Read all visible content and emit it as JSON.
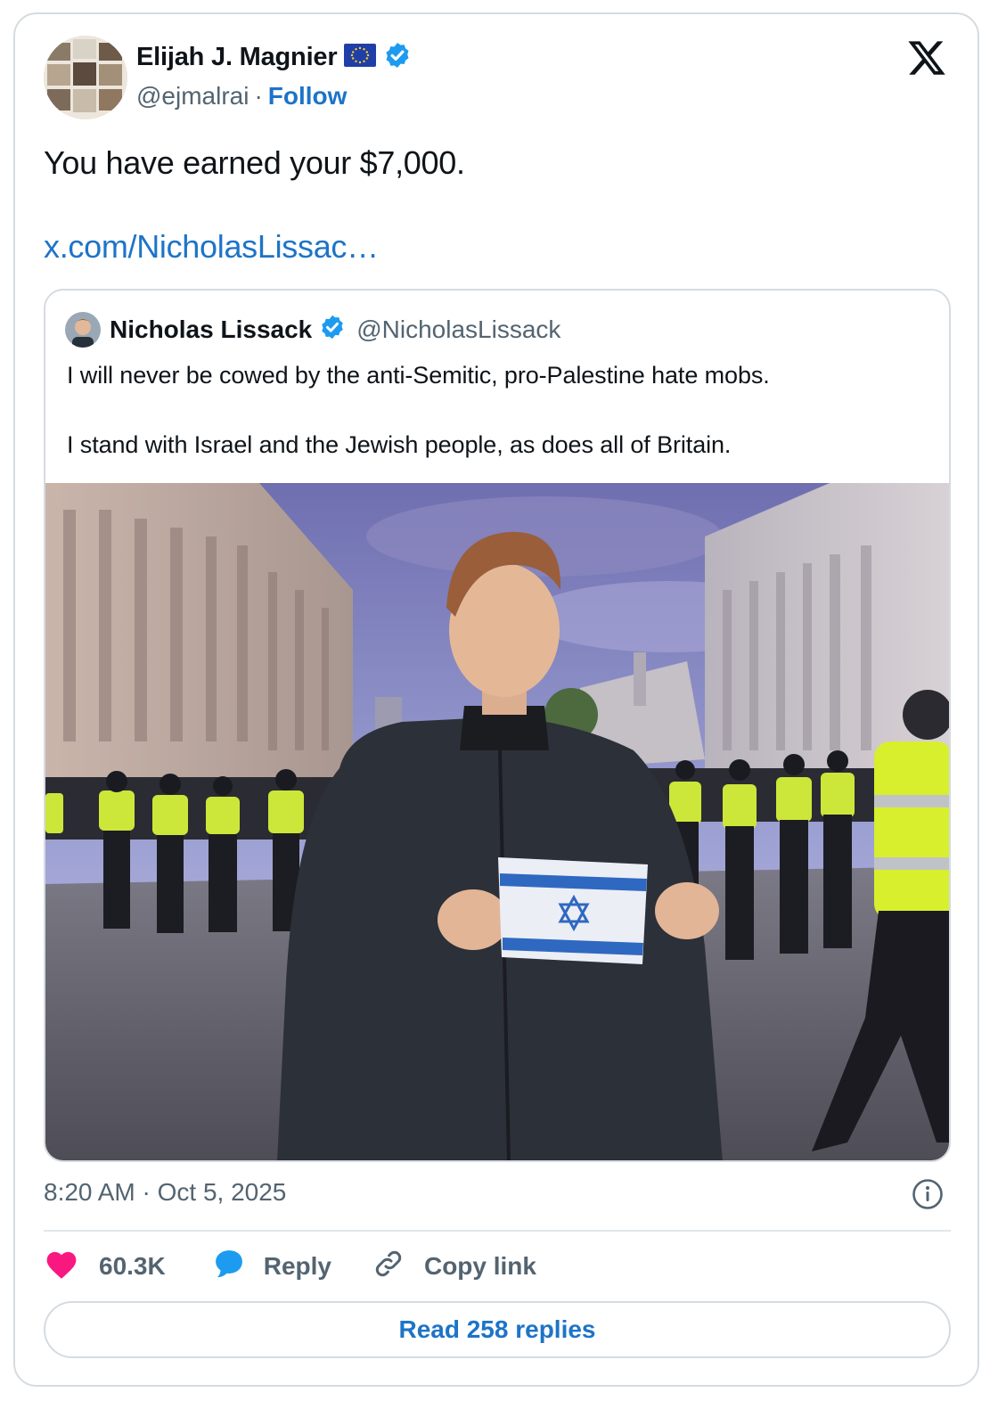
{
  "tweet": {
    "author": {
      "name": "Elijah J. Magnier",
      "handle": "@ejmalrai",
      "separator": "·",
      "follow_label": "Follow",
      "flag_icon": "eu-flag-icon",
      "verified_icon": "verified-badge-icon"
    },
    "text": "You have earned your $7,000.",
    "link": "x.com/NicholasLissac…",
    "timestamp": "8:20 AM · Oct 5, 2025",
    "likes": "60.3K",
    "reply_label": "Reply",
    "copy_link_label": "Copy link",
    "read_replies_label": "Read 258 replies"
  },
  "quoted_tweet": {
    "name": "Nicholas Lissack",
    "handle": "@NicholasLissack",
    "text_line_1": "I will never be cowed by the anti-Semitic, pro-Palestine hate mobs.",
    "text_line_2": "I stand with Israel and the Jewish people, as does all of Britain."
  },
  "colors": {
    "link_blue": "#1d74c8",
    "verified_blue": "#1d9bf0",
    "like_pink": "#f91880",
    "muted_text": "#536471",
    "border": "#d5dbe0"
  }
}
